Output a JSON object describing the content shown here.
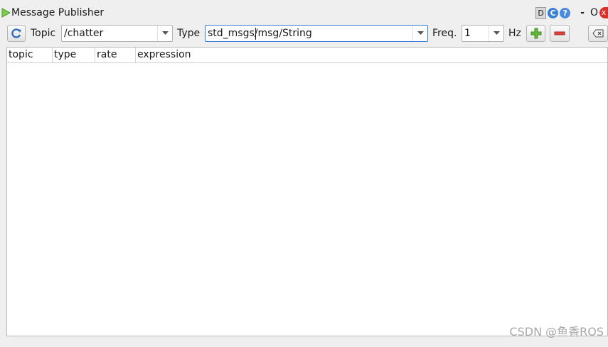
{
  "window": {
    "title": "Message Publisher",
    "buttons": {
      "d": "D",
      "reload": "C",
      "help": "?",
      "minimize": "-",
      "maximize": "O",
      "close": "x"
    }
  },
  "toolbar": {
    "refresh_icon": "refresh-icon",
    "topic_label": "Topic",
    "topic_value": "/chatter",
    "type_label": "Type",
    "type_value_pre": "std_msgs/",
    "type_value_post": "msg/String",
    "freq_label": "Freq.",
    "freq_value": "1",
    "hz_label": "Hz",
    "add_icon": "plus-icon",
    "remove_icon": "minus-icon",
    "clear_icon": "clear-icon"
  },
  "table": {
    "columns": [
      "topic",
      "type",
      "rate",
      "expression"
    ],
    "rows": []
  },
  "watermark": "CSDN @鱼香ROS",
  "colors": {
    "accent": "#3a7cd6",
    "add": "#5fb336",
    "remove": "#d9312a",
    "play": "#5db33a"
  }
}
